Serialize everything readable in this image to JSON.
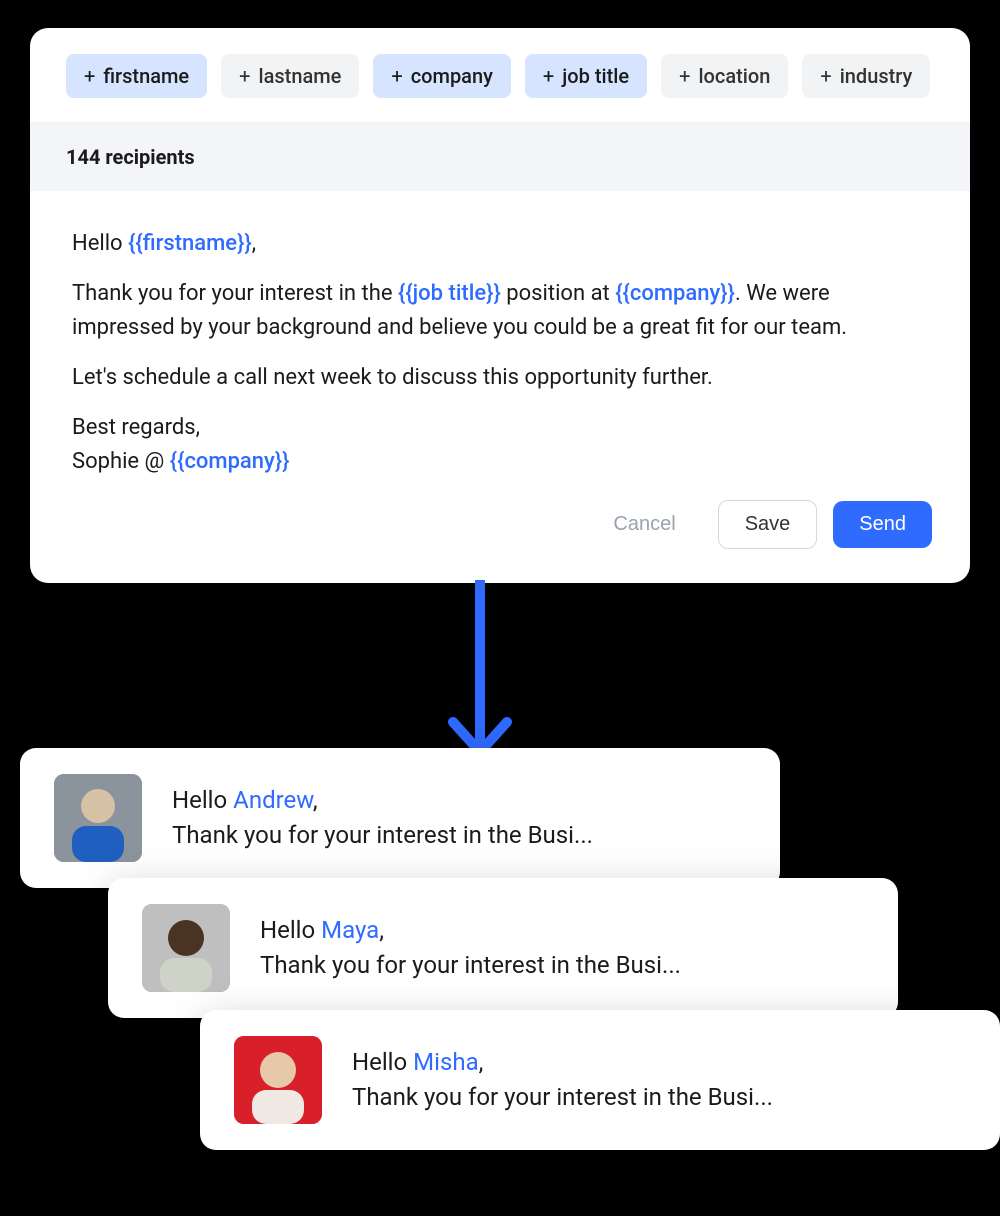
{
  "chips": [
    {
      "label": "firstname",
      "active": true
    },
    {
      "label": "lastname",
      "active": false
    },
    {
      "label": "company",
      "active": true
    },
    {
      "label": "job title",
      "active": true
    },
    {
      "label": "location",
      "active": false
    },
    {
      "label": "industry",
      "active": false
    }
  ],
  "recipients_text": "144 recipients",
  "template": {
    "greeting_prefix": "Hello ",
    "greeting_var": "{{firstname}}",
    "greeting_suffix": ",",
    "para1_a": "Thank you for your interest in the ",
    "para1_var1": "{{job title}}",
    "para1_b": " position at ",
    "para1_var2": "{{company}}",
    "para1_c": ". We were impressed by your background and believe you could be a great fit for our team.",
    "para2": "Let's schedule a call next week to discuss this opportunity further.",
    "signoff_a": "Best regards,",
    "signoff_b_prefix": "Sophie @ ",
    "signoff_b_var": "{{company}}"
  },
  "buttons": {
    "cancel": "Cancel",
    "save": "Save",
    "send": "Send"
  },
  "previews": [
    {
      "name": "Andrew",
      "line2": "Thank you for your interest in the Busi...",
      "avatar_bg": "#7f8a93"
    },
    {
      "name": "Maya",
      "line2": "Thank you for your interest in the Busi...",
      "avatar_bg": "#3d3d3d"
    },
    {
      "name": "Misha",
      "line2": "Thank you for your interest in the Busi...",
      "avatar_bg": "#d81f2a"
    }
  ],
  "preview_greeting_prefix": "Hello ",
  "preview_greeting_suffix": ","
}
